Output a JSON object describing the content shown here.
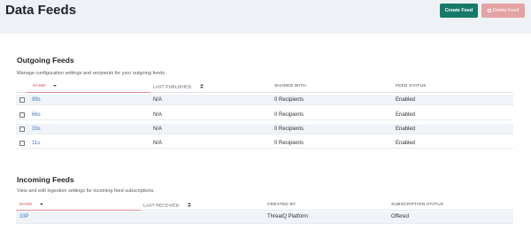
{
  "header": {
    "title": "Data Feeds",
    "create_label": "Create Feed",
    "delete_label": "Delete Feed"
  },
  "outgoing": {
    "title": "Outgoing Feeds",
    "description": "Manage configuration settings and recipients for your outgoing feeds.",
    "columns": [
      "NAME",
      "LAST PUBLISHED",
      "SHARED WITH",
      "FEED STATUS"
    ],
    "rows": [
      {
        "name": "99s",
        "last_published": "N/A",
        "shared_with": "0 Recipients",
        "status": "Enabled"
      },
      {
        "name": "66s",
        "last_published": "N/A",
        "shared_with": "0 Recipients",
        "status": "Enabled"
      },
      {
        "name": "33s",
        "last_published": "N/A",
        "shared_with": "0 Recipients",
        "status": "Enabled"
      },
      {
        "name": "11s",
        "last_published": "N/A",
        "shared_with": "0 Recipients",
        "status": "Enabled"
      }
    ]
  },
  "incoming": {
    "title": "Incoming Feeds",
    "description": "View and edit ingestion settings for incoming feed subscriptions.",
    "columns": [
      "NAME",
      "LAST RECEIVED",
      "CREATED BY",
      "SUBSCRIPTION STATUS"
    ],
    "rows": [
      {
        "name": "33P",
        "last_received": "",
        "created_by": "ThreatQ Platform",
        "status": "Offered"
      }
    ]
  },
  "icons": {
    "sort_desc": "caret-down-icon",
    "sort_both": "sort-icon",
    "delete": "trash-icon"
  },
  "colors": {
    "primary": "#157a6a",
    "danger_disabled": "#e3a3a3",
    "sorted_header": "#d64b5a",
    "link": "#3b79c4"
  }
}
